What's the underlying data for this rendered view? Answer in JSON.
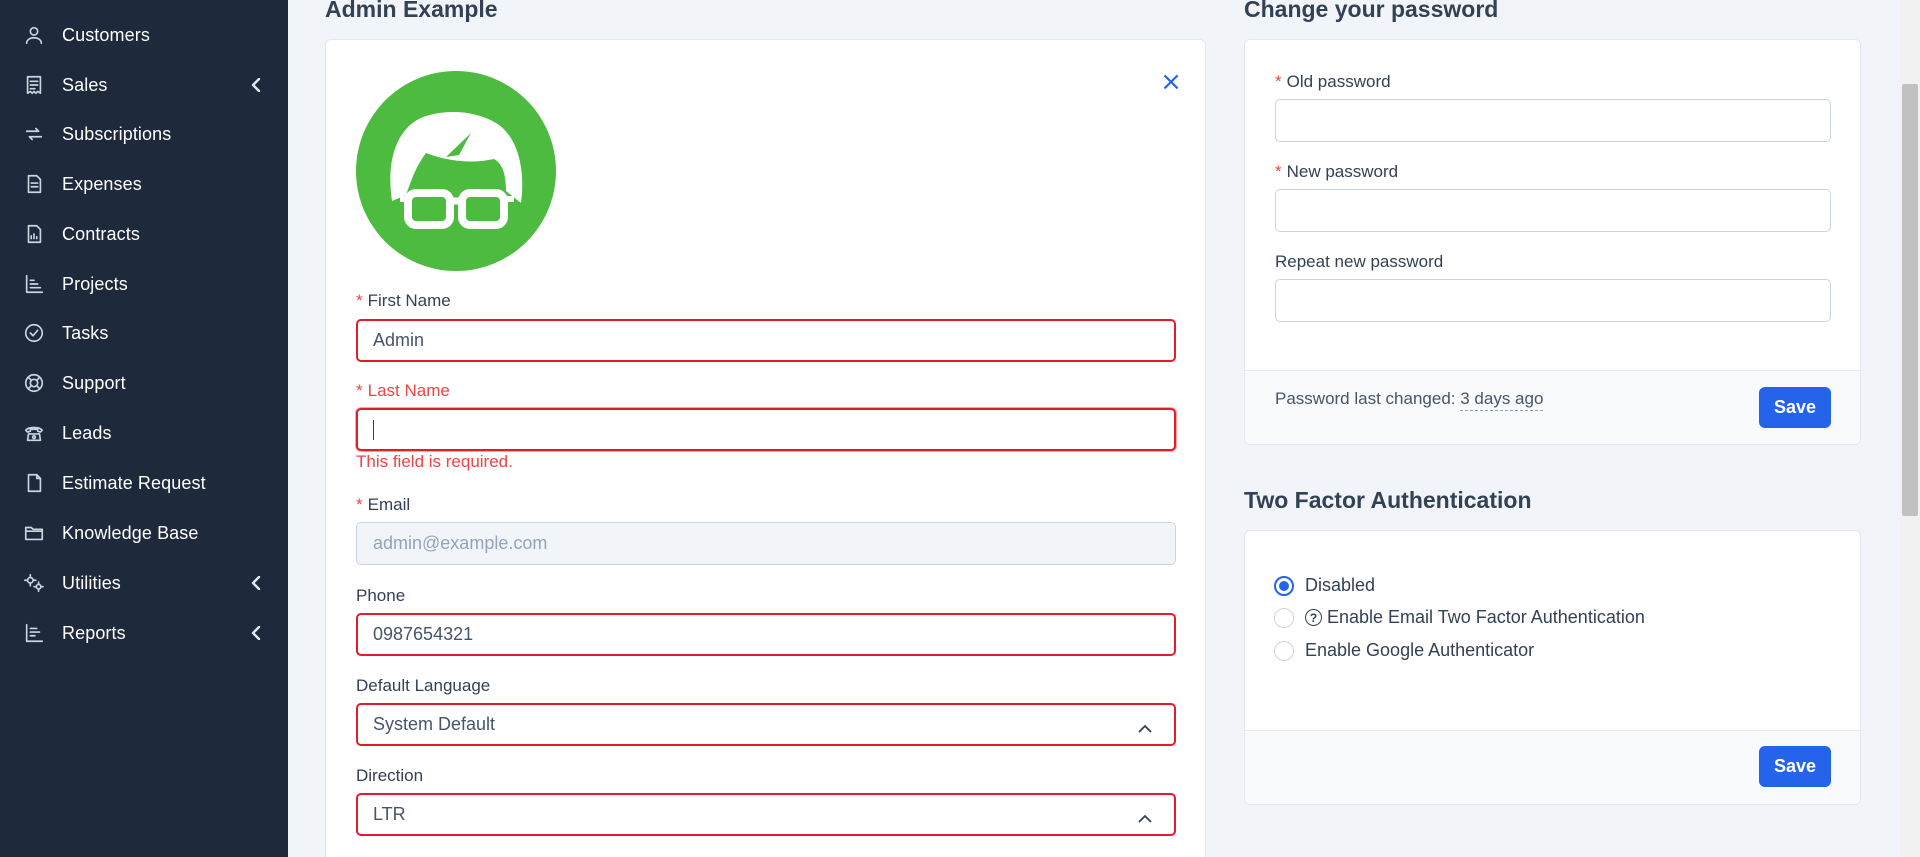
{
  "sidebar": {
    "items": [
      {
        "label": "Customers",
        "icon": "user-icon",
        "has_submenu": false
      },
      {
        "label": "Sales",
        "icon": "receipt-icon",
        "has_submenu": true
      },
      {
        "label": "Subscriptions",
        "icon": "repeat-icon",
        "has_submenu": false
      },
      {
        "label": "Expenses",
        "icon": "document-text-icon",
        "has_submenu": false
      },
      {
        "label": "Contracts",
        "icon": "document-chart-icon",
        "has_submenu": false
      },
      {
        "label": "Projects",
        "icon": "bar-chart-icon",
        "has_submenu": false
      },
      {
        "label": "Tasks",
        "icon": "check-circle-icon",
        "has_submenu": false
      },
      {
        "label": "Support",
        "icon": "lifebuoy-icon",
        "has_submenu": false
      },
      {
        "label": "Leads",
        "icon": "telephone-icon",
        "has_submenu": false
      },
      {
        "label": "Estimate Request",
        "icon": "document-icon",
        "has_submenu": false
      },
      {
        "label": "Knowledge Base",
        "icon": "folder-icon",
        "has_submenu": false
      },
      {
        "label": "Utilities",
        "icon": "cogs-icon",
        "has_submenu": true
      },
      {
        "label": "Reports",
        "icon": "chart-bars-icon",
        "has_submenu": true
      }
    ]
  },
  "profile": {
    "heading": "Admin Example",
    "close_label": "×",
    "first_name": {
      "label": "First Name",
      "value": "Admin"
    },
    "last_name": {
      "label": "Last Name",
      "value": "",
      "error": "This field is required."
    },
    "email": {
      "label": "Email",
      "placeholder": "admin@example.com"
    },
    "phone": {
      "label": "Phone",
      "value": "0987654321"
    },
    "default_language": {
      "label": "Default Language",
      "value": "System Default"
    },
    "direction": {
      "label": "Direction",
      "value": "LTR"
    }
  },
  "password": {
    "heading": "Change your password",
    "old_label": "Old password",
    "new_label": "New password",
    "repeat_label": "Repeat new password",
    "last_changed_label": "Password last changed:",
    "last_changed_value": "3 days ago",
    "save_label": "Save"
  },
  "two_factor": {
    "heading": "Two Factor Authentication",
    "options": [
      {
        "label": "Disabled",
        "checked": true
      },
      {
        "label": "Enable Email Two Factor Authentication",
        "checked": false
      },
      {
        "label": "Enable Google Authenticator",
        "checked": false
      }
    ],
    "save_label": "Save"
  },
  "colors": {
    "sidebar_bg": "#1e293b",
    "accent": "#2563eb",
    "error": "#e11d2d",
    "avatar_green": "#4cbb40"
  }
}
